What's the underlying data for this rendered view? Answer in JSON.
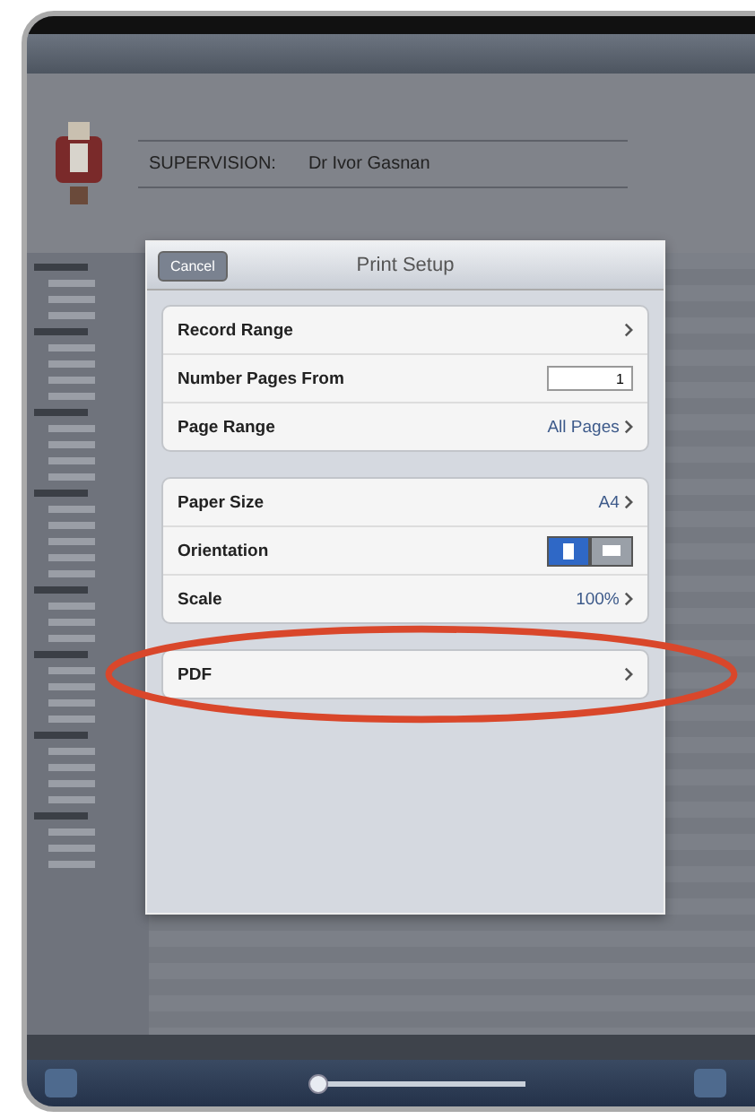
{
  "header": {
    "label": "SUPERVISION:",
    "name": "Dr Ivor Gasnan"
  },
  "dialog": {
    "cancel": "Cancel",
    "title": "Print Setup",
    "groups": [
      [
        {
          "kind": "link",
          "label": "Record Range"
        },
        {
          "kind": "field",
          "label": "Number Pages From",
          "value": "1"
        },
        {
          "kind": "link",
          "label": "Page Range",
          "value": "All Pages"
        }
      ],
      [
        {
          "kind": "link",
          "label": "Paper Size",
          "value": "A4"
        },
        {
          "kind": "segmented",
          "label": "Orientation",
          "options": [
            {
              "selected": true
            },
            {
              "selected": false
            }
          ]
        },
        {
          "kind": "link",
          "label": "Scale",
          "value": "100%"
        }
      ],
      [
        {
          "kind": "link",
          "label": "PDF",
          "highlighted": true
        }
      ]
    ]
  },
  "toolbar": {
    "page_slider": {
      "level": 0.03
    }
  }
}
